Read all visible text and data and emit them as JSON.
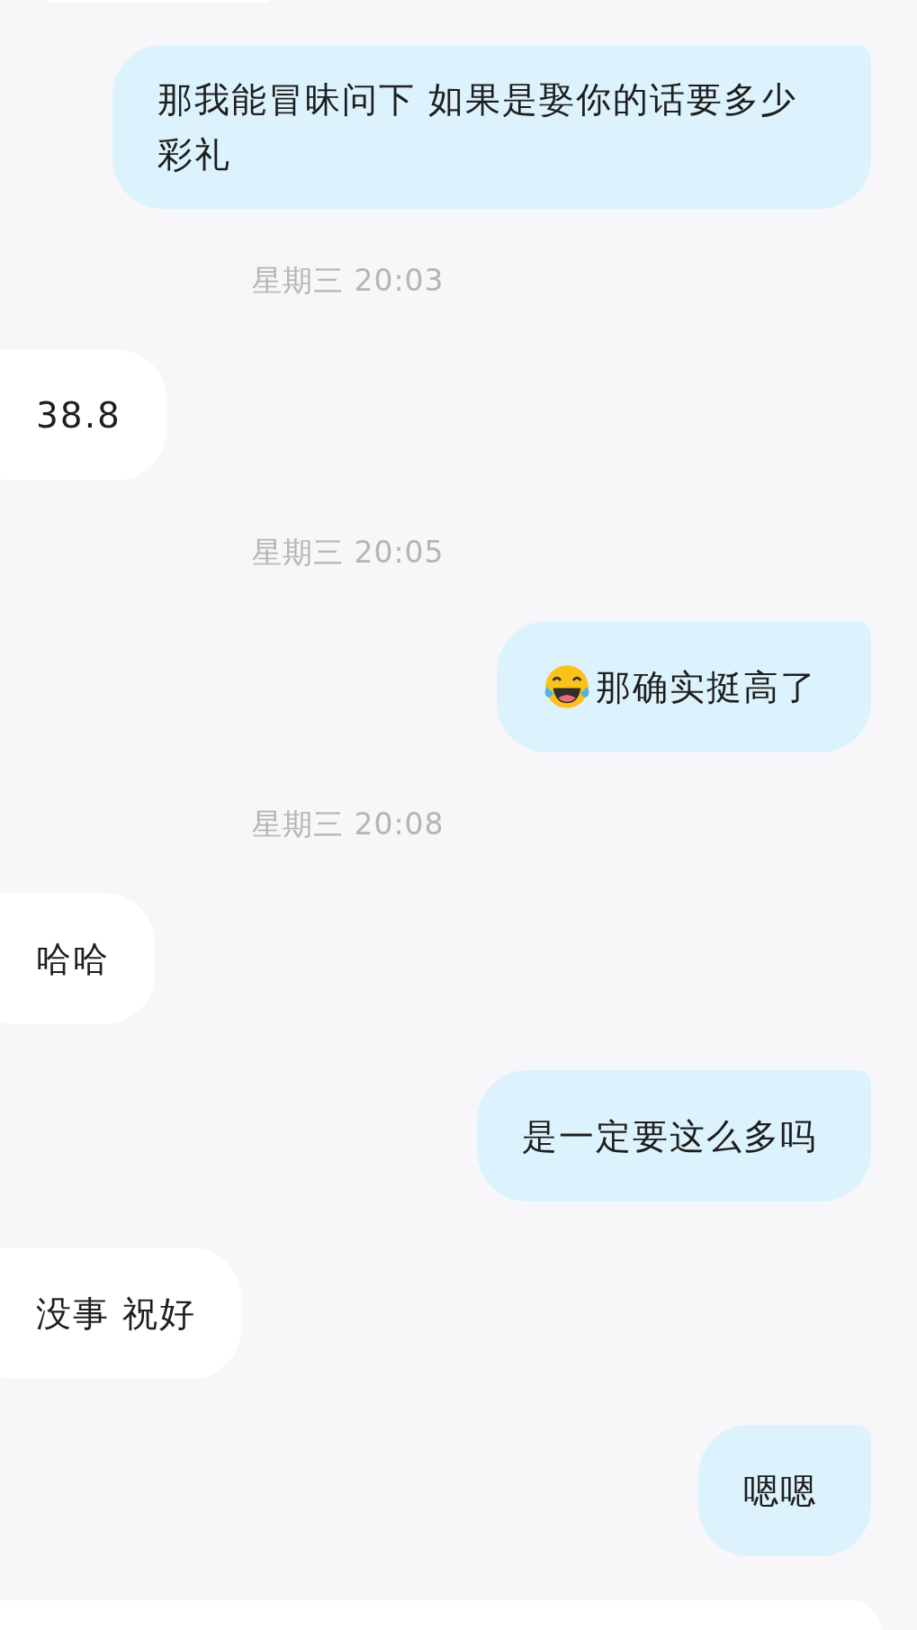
{
  "messages": [
    {
      "kind": "sent",
      "text": "那我能冒昧问下 如果是娶你的话要多少彩礼"
    },
    {
      "kind": "time",
      "text": "星期三 20:03"
    },
    {
      "kind": "received",
      "text": "38.8"
    },
    {
      "kind": "time",
      "text": "星期三 20:05"
    },
    {
      "kind": "sent",
      "text": "那确实挺高了",
      "has_emoji": true
    },
    {
      "kind": "time",
      "text": "星期三 20:08"
    },
    {
      "kind": "received",
      "text": "哈哈"
    },
    {
      "kind": "sent",
      "text": "是一定要这么多吗"
    },
    {
      "kind": "received",
      "text": "没事 祝好"
    },
    {
      "kind": "sent",
      "text": "嗯嗯"
    }
  ]
}
